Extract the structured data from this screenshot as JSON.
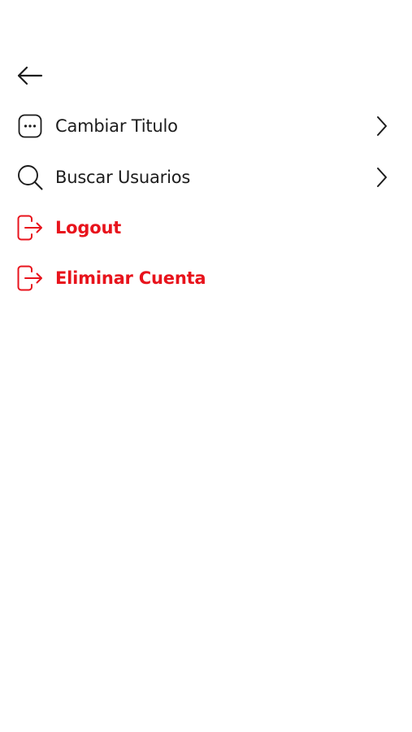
{
  "header": {
    "back_icon": "arrow-left-icon"
  },
  "menu": {
    "items": [
      {
        "label": "Cambiar Titulo",
        "icon": "chat-bubble-dots-icon",
        "has_chevron": true,
        "danger": false
      },
      {
        "label": "Buscar Usuarios",
        "icon": "search-icon",
        "has_chevron": true,
        "danger": false
      },
      {
        "label": "Logout",
        "icon": "logout-icon",
        "has_chevron": false,
        "danger": true
      },
      {
        "label": "Eliminar Cuenta",
        "icon": "logout-icon",
        "has_chevron": false,
        "danger": true
      }
    ]
  },
  "colors": {
    "text": "#1c1c1c",
    "danger": "#e8131c",
    "background": "#ffffff"
  }
}
